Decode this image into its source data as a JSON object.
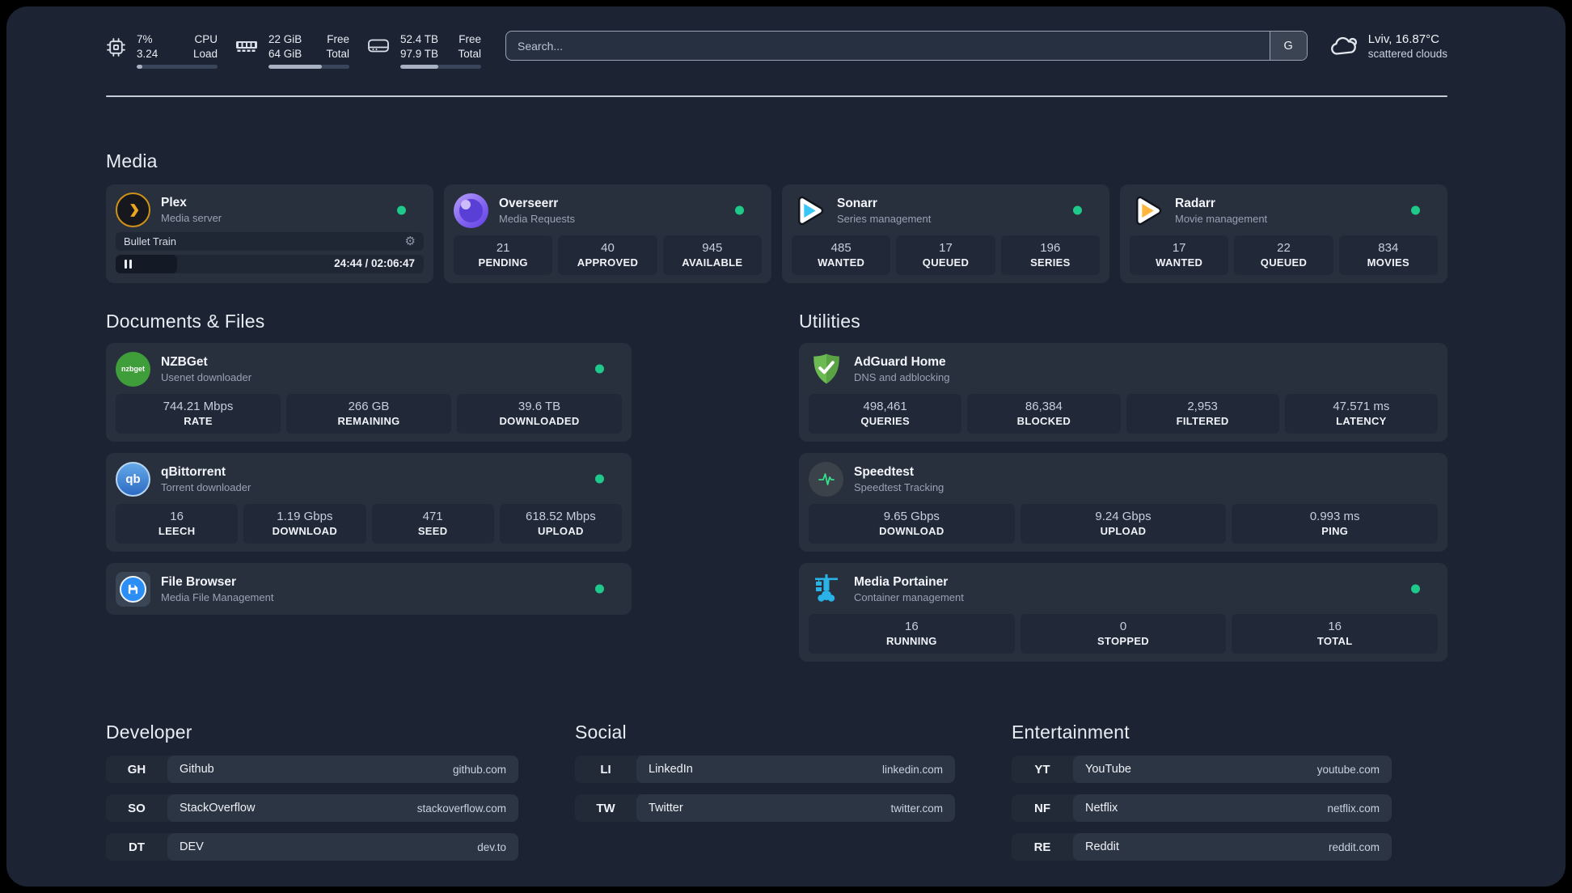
{
  "colors": {
    "background": "#1c2433",
    "card": "#28303e",
    "stat_box": "#212938",
    "status_online": "#1ec98a",
    "separator": "#c6ccd7"
  },
  "top_bar": {
    "stats": [
      {
        "icon": "cpu-icon",
        "line1_value": "7%",
        "line2_value": "3.24",
        "line1_label": "CPU",
        "line2_label": "Load",
        "usage_percent": 7
      },
      {
        "icon": "ram-icon",
        "line1_value": "22 GiB",
        "line2_value": "64 GiB",
        "line1_label": "Free",
        "line2_label": "Total",
        "usage_percent": 66
      },
      {
        "icon": "disk-icon",
        "line1_value": "52.4 TB",
        "line2_value": "97.9 TB",
        "line1_label": "Free",
        "line2_label": "Total",
        "usage_percent": 47
      }
    ],
    "search": {
      "placeholder": "Search...",
      "engine_button": "G"
    },
    "weather": {
      "location": "Lviv, 16.87°C",
      "condition": "scattered clouds"
    }
  },
  "sections": {
    "media": {
      "title": "Media",
      "plex": {
        "name": "Plex",
        "subtitle": "Media server",
        "status": "online",
        "now_playing": "Bullet Train",
        "elapsed_total": "24:44 / 02:06:47",
        "progress_percent": 20
      },
      "overseerr": {
        "name": "Overseerr",
        "subtitle": "Media Requests",
        "status": "online",
        "stats": [
          {
            "value": "21",
            "label": "PENDING"
          },
          {
            "value": "40",
            "label": "APPROVED"
          },
          {
            "value": "945",
            "label": "AVAILABLE"
          }
        ]
      },
      "sonarr": {
        "name": "Sonarr",
        "subtitle": "Series management",
        "status": "online",
        "stats": [
          {
            "value": "485",
            "label": "WANTED"
          },
          {
            "value": "17",
            "label": "QUEUED"
          },
          {
            "value": "196",
            "label": "SERIES"
          }
        ]
      },
      "radarr": {
        "name": "Radarr",
        "subtitle": "Movie management",
        "status": "online",
        "stats": [
          {
            "value": "17",
            "label": "WANTED"
          },
          {
            "value": "22",
            "label": "QUEUED"
          },
          {
            "value": "834",
            "label": "MOVIES"
          }
        ]
      }
    },
    "documents": {
      "title": "Documents & Files",
      "nzbget": {
        "name": "NZBGet",
        "subtitle": "Usenet downloader",
        "icon_text": "nzbget",
        "status": "online",
        "stats": [
          {
            "value": "744.21 Mbps",
            "label": "RATE"
          },
          {
            "value": "266 GB",
            "label": "REMAINING"
          },
          {
            "value": "39.6 TB",
            "label": "DOWNLOADED"
          }
        ]
      },
      "qbittorrent": {
        "name": "qBittorrent",
        "subtitle": "Torrent downloader",
        "icon_text": "qb",
        "status": "online",
        "stats": [
          {
            "value": "16",
            "label": "LEECH"
          },
          {
            "value": "1.19 Gbps",
            "label": "DOWNLOAD"
          },
          {
            "value": "471",
            "label": "SEED"
          },
          {
            "value": "618.52 Mbps",
            "label": "UPLOAD"
          }
        ]
      },
      "filebrowser": {
        "name": "File Browser",
        "subtitle": "Media File Management",
        "status": "online"
      }
    },
    "utilities": {
      "title": "Utilities",
      "adguard": {
        "name": "AdGuard Home",
        "subtitle": "DNS and adblocking",
        "stats": [
          {
            "value": "498,461",
            "label": "QUERIES"
          },
          {
            "value": "86,384",
            "label": "BLOCKED"
          },
          {
            "value": "2,953",
            "label": "FILTERED"
          },
          {
            "value": "47.571 ms",
            "label": "LATENCY"
          }
        ]
      },
      "speedtest": {
        "name": "Speedtest",
        "subtitle": "Speedtest Tracking",
        "stats": [
          {
            "value": "9.65 Gbps",
            "label": "DOWNLOAD"
          },
          {
            "value": "9.24 Gbps",
            "label": "UPLOAD"
          },
          {
            "value": "0.993 ms",
            "label": "PING"
          }
        ]
      },
      "portainer": {
        "name": "Media Portainer",
        "subtitle": "Container management",
        "status": "online",
        "stats": [
          {
            "value": "16",
            "label": "RUNNING"
          },
          {
            "value": "0",
            "label": "STOPPED"
          },
          {
            "value": "16",
            "label": "TOTAL"
          }
        ]
      }
    },
    "developer": {
      "title": "Developer",
      "links": [
        {
          "abbr": "GH",
          "name": "Github",
          "url": "github.com"
        },
        {
          "abbr": "SO",
          "name": "StackOverflow",
          "url": "stackoverflow.com"
        },
        {
          "abbr": "DT",
          "name": "DEV",
          "url": "dev.to"
        }
      ]
    },
    "social": {
      "title": "Social",
      "links": [
        {
          "abbr": "LI",
          "name": "LinkedIn",
          "url": "linkedin.com"
        },
        {
          "abbr": "TW",
          "name": "Twitter",
          "url": "twitter.com"
        }
      ]
    },
    "entertainment": {
      "title": "Entertainment",
      "links": [
        {
          "abbr": "YT",
          "name": "YouTube",
          "url": "youtube.com"
        },
        {
          "abbr": "NF",
          "name": "Netflix",
          "url": "netflix.com"
        },
        {
          "abbr": "RE",
          "name": "Reddit",
          "url": "reddit.com"
        }
      ]
    }
  }
}
